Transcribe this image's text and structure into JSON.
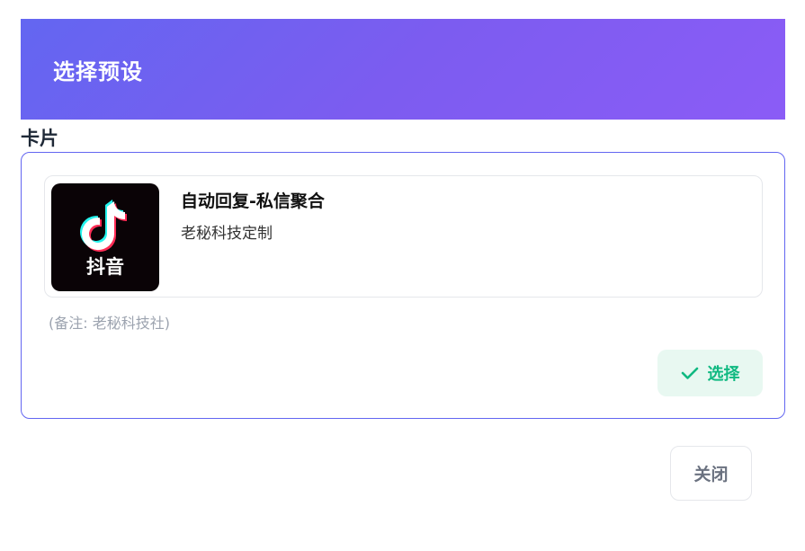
{
  "dialog": {
    "title": "选择预设",
    "close_label": "关闭"
  },
  "section": {
    "label": "卡片"
  },
  "card": {
    "thumbnail_text": "抖音",
    "title": "自动回复-私信聚合",
    "subtitle": "老秘科技定制",
    "note": "(备注: 老秘科技社)",
    "select_label": "选择"
  },
  "icons": {
    "thumbnail": "douyin-logo-icon",
    "select": "check-icon"
  },
  "colors": {
    "header_gradient_start": "#6366f1",
    "header_gradient_end": "#8b5cf6",
    "accent_border": "#6366f1",
    "select_text": "#10b981",
    "select_bg": "#e8f8f1"
  }
}
